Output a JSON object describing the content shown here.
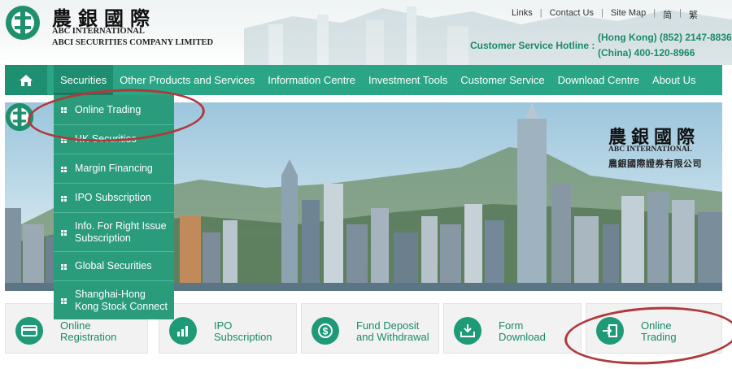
{
  "header": {
    "logo_cn": "農銀國際",
    "logo_en_line1": "ABC INTERNATIONAL",
    "logo_en_line2": "ABCI SECURITIES COMPANY LIMITED",
    "links": [
      "Links",
      "Contact Us",
      "Site Map",
      "简",
      "繁"
    ],
    "hotline_label": "Customer Service Hotline :",
    "hotline_hk": "(Hong Kong) (852) 2147-8836",
    "hotline_china": "(China) 400-120-8966"
  },
  "nav": {
    "items": [
      "Securities",
      "Other Products and Services",
      "Information Centre",
      "Investment Tools",
      "Customer Service",
      "Download Centre",
      "About Us"
    ],
    "active": "Securities"
  },
  "banner": {
    "logo_cn": "農銀國際",
    "logo_en": "ABC INTERNATIONAL",
    "logo_cn_sub": "農銀國際證券有限公司"
  },
  "dropdown": {
    "items": [
      "Online Trading",
      "HK Securities",
      "Margin Financing",
      "IPO Subscription",
      "Info. For Right Issue Subscription",
      "Global Securities",
      "Shanghai-Hong Kong Stock Connect"
    ]
  },
  "quick_links": [
    {
      "line1": "Online",
      "line2": "Registration",
      "icon": "card-icon"
    },
    {
      "line1": "IPO",
      "line2": "Subscription",
      "icon": "bar-chart-icon"
    },
    {
      "line1": "Fund Deposit",
      "line2": "and Withdrawal",
      "icon": "dollar-icon"
    },
    {
      "line1": "Form",
      "line2": "Download",
      "icon": "download-icon"
    },
    {
      "line1": "Online",
      "line2": "Trading",
      "icon": "login-icon"
    }
  ],
  "colors": {
    "brand_green": "#2aa585",
    "dropdown_green": "#2a9c7c",
    "annotation_red": "#b0393c"
  }
}
